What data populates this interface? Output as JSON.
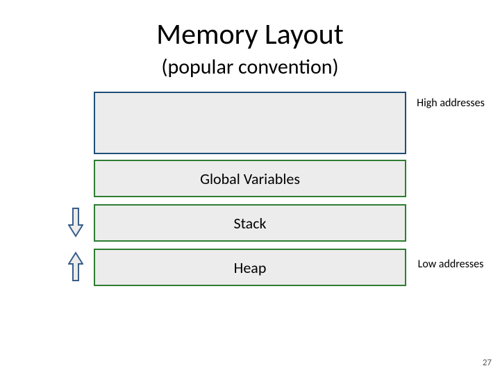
{
  "title": "Memory Layout",
  "subtitle": "(popular convention)",
  "boxes": {
    "top": "",
    "globals": "Global Variables",
    "stack": "Stack",
    "heap": "Heap"
  },
  "labels": {
    "high": "High addresses",
    "low": "Low addresses"
  },
  "icons": {
    "down": "arrow-down-icon",
    "up": "arrow-up-icon"
  },
  "page_number": "27"
}
